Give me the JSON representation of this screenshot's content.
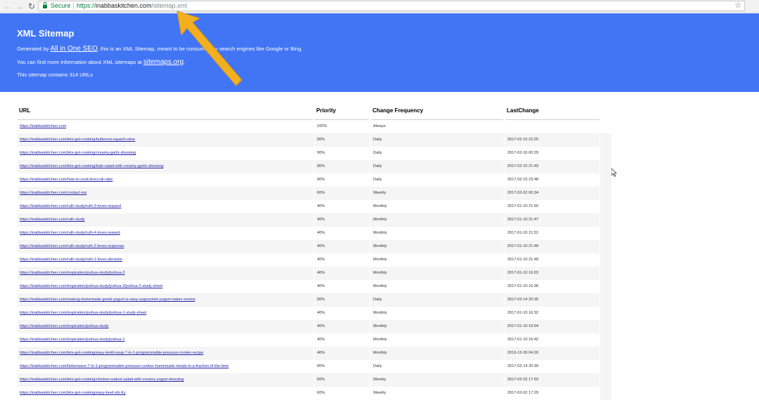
{
  "browser": {
    "secure_label": "Secure",
    "url_scheme": "https://",
    "url_host": "inabbaskitchen.com",
    "url_path": "/sitemap.xml"
  },
  "header": {
    "title": "XML Sitemap",
    "line1_prefix": "Generated by ",
    "line1_link": "All in One SEO",
    "line1_suffix": ", this is an XML Sitemap, meant to be consumed by search engines like Google or Bing.",
    "line2_prefix": "You can find more information about XML sitemaps at ",
    "line2_link": "sitemaps.org",
    "line2_suffix": ".",
    "line3": "This sitemap contains 314 URLs",
    "colors": {
      "background": "#4275f4",
      "arrow": "#f2b01e"
    }
  },
  "table": {
    "columns": [
      "URL",
      "Priority",
      "Change Frequency",
      "LastChange"
    ],
    "rows": [
      {
        "url": "https://inabbaskitchen.com",
        "priority": "100%",
        "freq": "Always",
        "date": ""
      },
      {
        "url": "https://inabbaskitchen.com/lets-get-cooking/butternut-squash-stew",
        "priority": "90%",
        "freq": "Daily",
        "date": "2017-02-15 22:25"
      },
      {
        "url": "https://inabbaskitchen.com/lets-get-cooking/creamy-garlic-dressing",
        "priority": "90%",
        "freq": "Daily",
        "date": "2017-02-16 00:29"
      },
      {
        "url": "https://inabbaskitchen.com/lets-get-cooking/kale-salad-with-creamy-garlic-dressing",
        "priority": "90%",
        "freq": "Daily",
        "date": "2017-02-15 21:43"
      },
      {
        "url": "https://inabbaskitchen.com/how-to-cook-broccoli-rabe",
        "priority": "90%",
        "freq": "Daily",
        "date": "2017-02-15 23:48"
      },
      {
        "url": "https://inabbaskitchen.com/contact-me",
        "priority": "60%",
        "freq": "Weekly",
        "date": "2017-02-02 00:34"
      },
      {
        "url": "https://inabbaskitchen.com/ruth-study/ruth-3-loves-request",
        "priority": "40%",
        "freq": "Monthly",
        "date": "2017-01-10 21:50"
      },
      {
        "url": "https://inabbaskitchen.com/ruth-study",
        "priority": "40%",
        "freq": "Monthly",
        "date": "2017-01-10 21:47"
      },
      {
        "url": "https://inabbaskitchen.com/ruth-study/ruth-4-loves-reward",
        "priority": "40%",
        "freq": "Monthly",
        "date": "2017-01-10 21:51"
      },
      {
        "url": "https://inabbaskitchen.com/ruth-study/ruth-2-loves-response",
        "priority": "40%",
        "freq": "Monthly",
        "date": "2017-01-10 21:49"
      },
      {
        "url": "https://inabbaskitchen.com/ruth-study/ruth-1-loves-decision",
        "priority": "40%",
        "freq": "Monthly",
        "date": "2017-01-10 21:49"
      },
      {
        "url": "https://inabbaskitchen.com/inspiration/joshua-study/joshua-2",
        "priority": "40%",
        "freq": "Monthly",
        "date": "2017-01-10 16:03"
      },
      {
        "url": "https://inabbaskitchen.com/inspiration/joshua-study/joshua-2/joshua-2-study-sheet",
        "priority": "40%",
        "freq": "Monthly",
        "date": "2017-01-10 16:36"
      },
      {
        "url": "https://inabbaskitchen.com/making-homemade-greek-yogurt-is-easy-yogourmet-yogurt-maker-review",
        "priority": "90%",
        "freq": "Daily",
        "date": "2017-02-14 20:35"
      },
      {
        "url": "https://inabbaskitchen.com/inspiration/joshua-study/joshua-1-study-sheet",
        "priority": "40%",
        "freq": "Monthly",
        "date": "2017-01-10 16:32"
      },
      {
        "url": "https://inabbaskitchen.com/inspiration/joshua-study",
        "priority": "40%",
        "freq": "Monthly",
        "date": "2017-01-10 16:04"
      },
      {
        "url": "https://inabbaskitchen.com/inspiration/joshua-study/joshua-1",
        "priority": "40%",
        "freq": "Monthly",
        "date": "2017-01-10 16:42"
      },
      {
        "url": "https://inabbaskitchen.com/lets-get-cooking/easy-lentil-soup-7-in-1-programmable-pressure-cooker-recipe",
        "priority": "40%",
        "freq": "Monthly",
        "date": "2016-12-30 04:20"
      },
      {
        "url": "https://inabbaskitchen.com/farberware-7-in-1-programmable-pressure-cooker-homemade-meals-in-a-fraction-of-the-time",
        "priority": "90%",
        "freq": "Daily",
        "date": "2017-02-14 20:39"
      },
      {
        "url": "https://inabbaskitchen.com/lets-get-cooking/chicken-walnut-salad-with-creamy-yogurt-dressing",
        "priority": "60%",
        "freq": "Weekly",
        "date": "2017-02-02 17:03"
      },
      {
        "url": "https://inabbaskitchen.com/lets-get-cooking/easy-beef-stir-fry",
        "priority": "60%",
        "freq": "Weekly",
        "date": "2017-02-02 17:29"
      }
    ]
  }
}
